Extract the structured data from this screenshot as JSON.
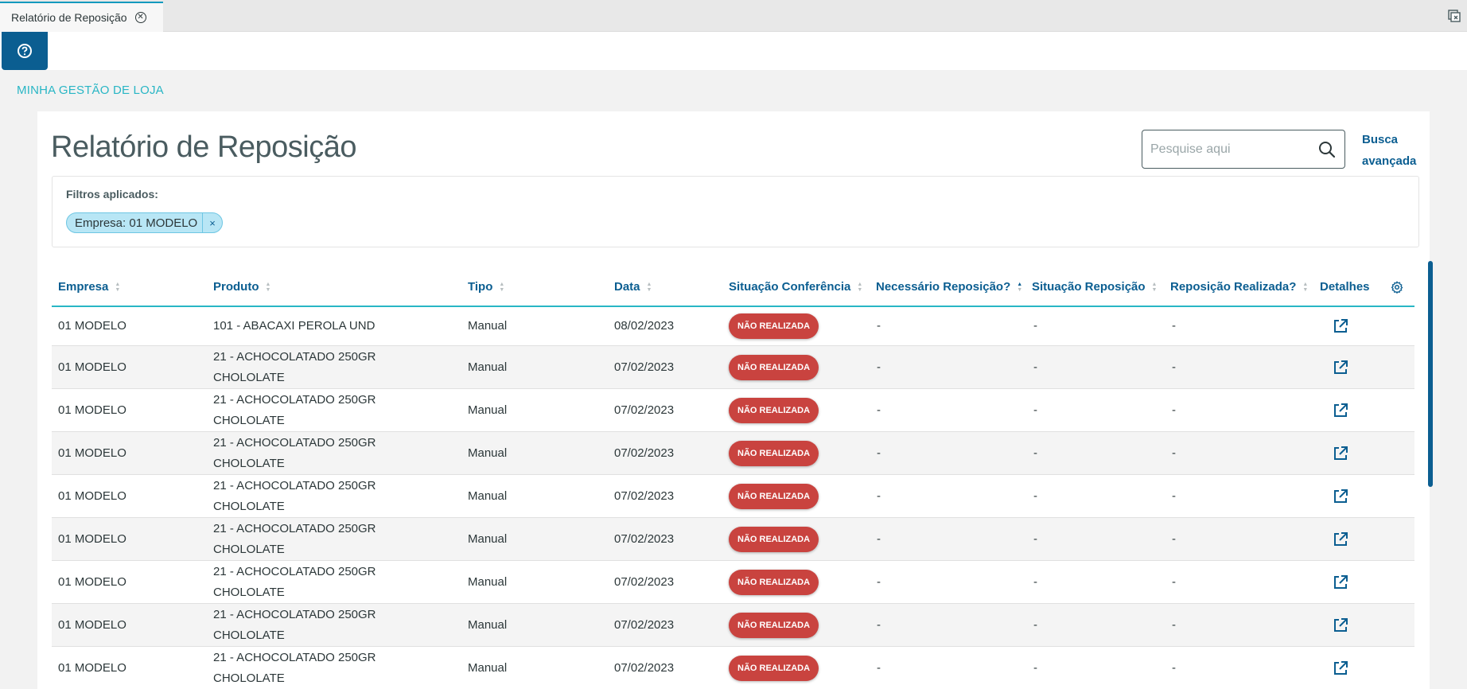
{
  "tab": {
    "title": "Relatório de Reposição"
  },
  "toolbar": {
    "help_icon": "help-circle-icon"
  },
  "breadcrumb": "MINHA GESTÃO DE LOJA",
  "page": {
    "title": "Relatório de Reposição",
    "search_placeholder": "Pesquise aqui",
    "advanced_search": "Busca avançada"
  },
  "filters": {
    "title": "Filtros aplicados:",
    "chips": [
      {
        "label": "Empresa: 01 MODELO",
        "remove": "×"
      }
    ]
  },
  "table": {
    "columns": [
      "Empresa",
      "Produto",
      "Tipo",
      "Data",
      "Situação Conferência",
      "Necessário Reposição?",
      "Situação Reposição",
      "Reposição Realizada?",
      "Detalhes"
    ],
    "sorted_column": "Necessário Reposição?",
    "rows": [
      {
        "empresa": "01 MODELO",
        "produto": "101 - ABACAXI PEROLA UND",
        "tipo": "Manual",
        "data": "08/02/2023",
        "situacao": "NÃO REALIZADA",
        "necessario": "-",
        "situacao_rep": "-",
        "realizada": "-"
      },
      {
        "empresa": "01 MODELO",
        "produto": "21 - ACHOCOLATADO 250GR CHOLOLATE",
        "tipo": "Manual",
        "data": "07/02/2023",
        "situacao": "NÃO REALIZADA",
        "necessario": "-",
        "situacao_rep": "-",
        "realizada": "-"
      },
      {
        "empresa": "01 MODELO",
        "produto": "21 - ACHOCOLATADO 250GR CHOLOLATE",
        "tipo": "Manual",
        "data": "07/02/2023",
        "situacao": "NÃO REALIZADA",
        "necessario": "-",
        "situacao_rep": "-",
        "realizada": "-"
      },
      {
        "empresa": "01 MODELO",
        "produto": "21 - ACHOCOLATADO 250GR CHOLOLATE",
        "tipo": "Manual",
        "data": "07/02/2023",
        "situacao": "NÃO REALIZADA",
        "necessario": "-",
        "situacao_rep": "-",
        "realizada": "-"
      },
      {
        "empresa": "01 MODELO",
        "produto": "21 - ACHOCOLATADO 250GR CHOLOLATE",
        "tipo": "Manual",
        "data": "07/02/2023",
        "situacao": "NÃO REALIZADA",
        "necessario": "-",
        "situacao_rep": "-",
        "realizada": "-"
      },
      {
        "empresa": "01 MODELO",
        "produto": "21 - ACHOCOLATADO 250GR CHOLOLATE",
        "tipo": "Manual",
        "data": "07/02/2023",
        "situacao": "NÃO REALIZADA",
        "necessario": "-",
        "situacao_rep": "-",
        "realizada": "-"
      },
      {
        "empresa": "01 MODELO",
        "produto": "21 - ACHOCOLATADO 250GR CHOLOLATE",
        "tipo": "Manual",
        "data": "07/02/2023",
        "situacao": "NÃO REALIZADA",
        "necessario": "-",
        "situacao_rep": "-",
        "realizada": "-"
      },
      {
        "empresa": "01 MODELO",
        "produto": "21 - ACHOCOLATADO 250GR CHOLOLATE",
        "tipo": "Manual",
        "data": "07/02/2023",
        "situacao": "NÃO REALIZADA",
        "necessario": "-",
        "situacao_rep": "-",
        "realizada": "-"
      },
      {
        "empresa": "01 MODELO",
        "produto": "21 - ACHOCOLATADO 250GR CHOLOLATE",
        "tipo": "Manual",
        "data": "07/02/2023",
        "situacao": "NÃO REALIZADA",
        "necessario": "-",
        "situacao_rep": "-",
        "realizada": "-"
      }
    ]
  },
  "colors": {
    "primary": "#0b5e91",
    "accent": "#29b6c5",
    "danger": "#c9433f"
  }
}
